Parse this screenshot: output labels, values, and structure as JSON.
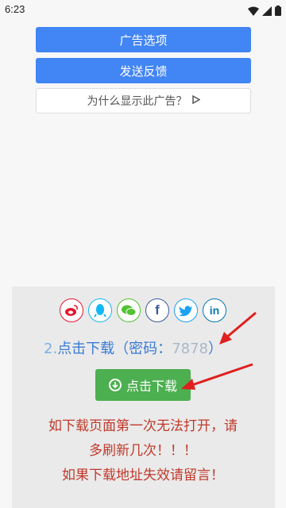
{
  "status_bar": {
    "time": "6:23"
  },
  "ad": {
    "options_label": "广告选项",
    "feedback_label": "发送反馈",
    "why_label": "为什么显示此广告？"
  },
  "share": {
    "icons": [
      "weibo-icon",
      "qq-icon",
      "wechat-icon",
      "facebook-icon",
      "twitter-icon",
      "linkedin-icon"
    ],
    "colors": {
      "weibo": "#e6162d",
      "qq": "#12b7f5",
      "wechat": "#51c332",
      "facebook": "#3b5998",
      "twitter": "#1da1f2",
      "linkedin": "#0077b5"
    }
  },
  "download": {
    "prefix": "2.",
    "label": "点击下载（密码：",
    "password": "7878",
    "suffix": "）",
    "button_label": "点击下载"
  },
  "notice": {
    "line1": "如下载页面第一次无法打开，请",
    "line2": "多刷新几次！！！",
    "line3": "如果下载地址失效请留言！"
  }
}
